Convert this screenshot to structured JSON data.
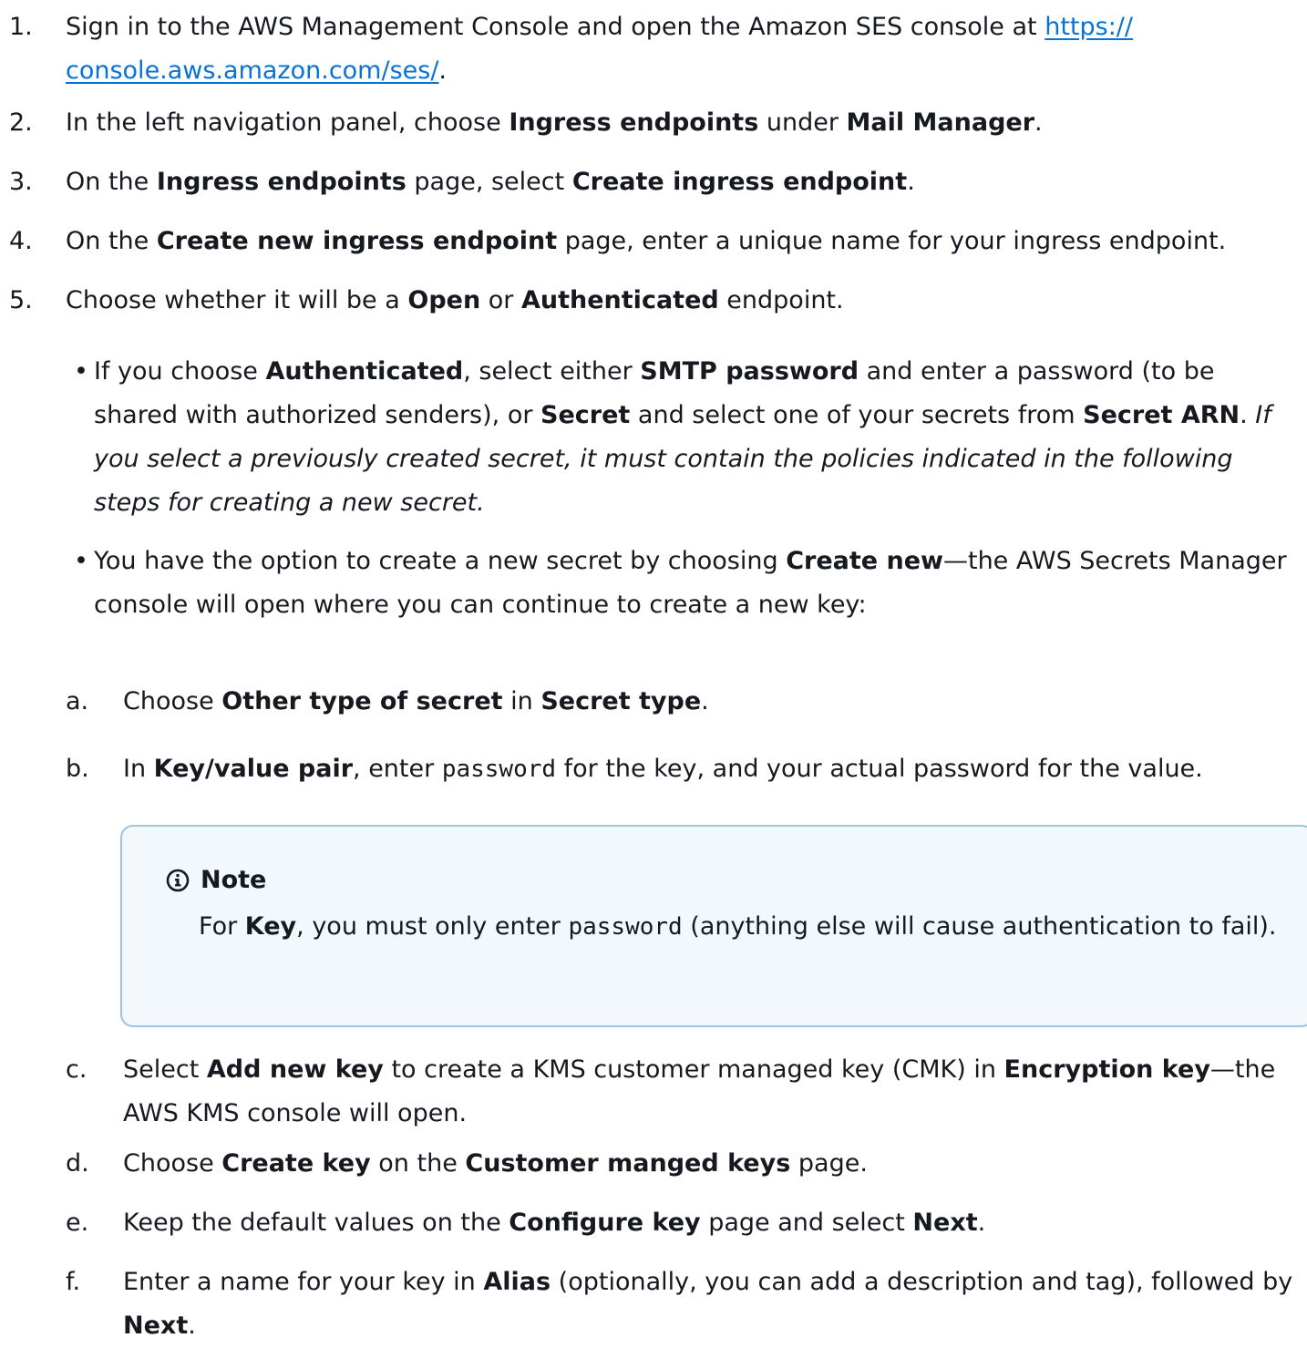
{
  "steps": [
    {
      "num": "1.",
      "parts": [
        "Sign in to the AWS Management Console and open the Amazon SES console at "
      ],
      "link": "https://\nconsole.aws.amazon.com/ses/",
      "after": "."
    },
    {
      "num": "2.",
      "t1": "In the left navigation panel, choose ",
      "b1": "Ingress endpoints",
      "t2": " under ",
      "b2": "Mail Manager",
      "t3": "."
    },
    {
      "num": "3.",
      "t1": "On the ",
      "b1": "Ingress endpoints",
      "t2": " page, select ",
      "b2": "Create ingress endpoint",
      "t3": "."
    },
    {
      "num": "4.",
      "t1": "On the ",
      "b1": "Create new ingress endpoint",
      "t2": " page, enter a unique name for your ingress endpoint."
    },
    {
      "num": "5.",
      "t1": "Choose whether it will be a ",
      "b1": "Open",
      "t2": " or ",
      "b2": "Authenticated",
      "t3": " endpoint."
    }
  ],
  "step1": {
    "num": "1.",
    "text": "Sign in to the AWS Management Console and open the Amazon SES console at ",
    "link_line1": "https://",
    "link_line2": "console.aws.amazon.com/ses/",
    "after": "."
  },
  "step2": {
    "num": "2.",
    "t1": "In the left navigation panel, choose ",
    "b1": "Ingress endpoints",
    "t2": " under ",
    "b2": "Mail Manager",
    "t3": "."
  },
  "step3": {
    "num": "3.",
    "t1": "On the ",
    "b1": "Ingress endpoints",
    "t2": " page, select ",
    "b2": "Create ingress endpoint",
    "t3": "."
  },
  "step4": {
    "num": "4.",
    "t1": "On the ",
    "b1": "Create new ingress endpoint",
    "t2": " page, enter a unique name for your ingress endpoint."
  },
  "step5": {
    "num": "5.",
    "t1": "Choose whether it will be a ",
    "b1": "Open",
    "t2": " or ",
    "b2": "Authenticated",
    "t3": " endpoint."
  },
  "bullet1": {
    "dot": "•",
    "t1": "If you choose ",
    "b1": "Authenticated",
    "t2": ", select either ",
    "b2": "SMTP password",
    "t3": " and enter a password (to be shared with authorized senders), or ",
    "b3": "Secret",
    "t4": " and select one of your secrets from ",
    "b4": "Secret ARN",
    "t5": ". ",
    "i1": "If you select a previously created secret, it must contain the policies indicated in the following steps for creating a new secret."
  },
  "bullet2": {
    "dot": "•",
    "t1": "You have the option to create a new secret by choosing ",
    "b1": "Create new",
    "t2": "—the AWS Secrets Manager console will open where you can continue to create a new key:"
  },
  "sub_a": {
    "num": "a.",
    "t1": "Choose ",
    "b1": "Other type of secret",
    "t2": " in ",
    "b2": "Secret type",
    "t3": "."
  },
  "sub_b": {
    "num": "b.",
    "t1": "In ",
    "b1": "Key/value pair",
    "t2": ", enter ",
    "c1": "password",
    "t3": " for the key, and your actual password for the value."
  },
  "note": {
    "icon": "info-icon",
    "title": "Note",
    "t1": "For ",
    "b1": "Key",
    "t2": ", you must only enter ",
    "c1": "password",
    "t3": " (anything else will cause authentication to fail)."
  },
  "sub_c": {
    "num": "c.",
    "t1": "Select ",
    "b1": "Add new key",
    "t2": " to create a KMS customer managed key (CMK) in ",
    "b2": "Encryption key",
    "t3": "—the AWS KMS console will open."
  },
  "sub_d": {
    "num": "d.",
    "t1": "Choose ",
    "b1": "Create key",
    "t2": " on the ",
    "b2": "Customer manged keys",
    "t3": " page."
  },
  "sub_e": {
    "num": "e.",
    "t1": "Keep the default values on the ",
    "b1": "Configure key",
    "t2": " page and select ",
    "b2": "Next",
    "t3": "."
  },
  "sub_f": {
    "num": "f.",
    "t1": "Enter a name for your key in ",
    "b1": "Alias",
    "t2": " (optionally, you can add a description and tag), followed by ",
    "b2": "Next",
    "t3": "."
  },
  "colors": {
    "link": "#0972d3",
    "note_border": "#9dc3e0",
    "note_bg": "#f3f8fc",
    "text": "#16191f"
  }
}
